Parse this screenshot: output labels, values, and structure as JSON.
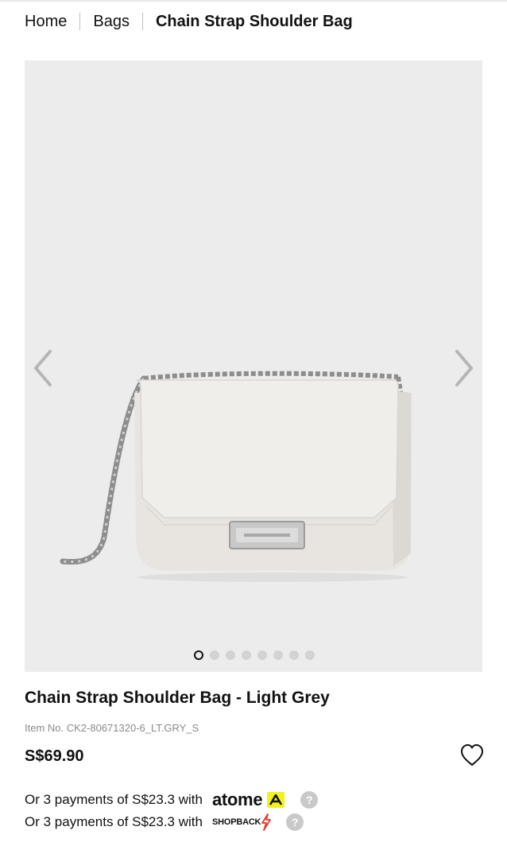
{
  "breadcrumb": {
    "home": "Home",
    "category": "Bags",
    "current": "Chain Strap Shoulder Bag"
  },
  "gallery": {
    "image_alt": "Chain Strap Shoulder Bag - Light Grey",
    "prev_icon": "chevron-left-icon",
    "next_icon": "chevron-right-icon",
    "slide_count": 8,
    "active_slide": 1,
    "background": "#ececec"
  },
  "product": {
    "title": "Chain Strap Shoulder Bag - Light Grey",
    "item_no": "Item No. CK2-80671320-6_LT.GRY_S",
    "price": "S$69.90",
    "wishlist_icon": "heart-outline-icon"
  },
  "payments": [
    {
      "text": "Or 3 payments of S$23.3 with",
      "provider": "atome",
      "help": "?"
    },
    {
      "text": "Or 3 payments of S$23.3 with",
      "provider": "SHOPBACK",
      "help": "?"
    }
  ],
  "colors": {
    "atome_badge": "#f2f21e",
    "shopback_bolt": "#e8392f",
    "help_circle": "#c9c9c9"
  }
}
